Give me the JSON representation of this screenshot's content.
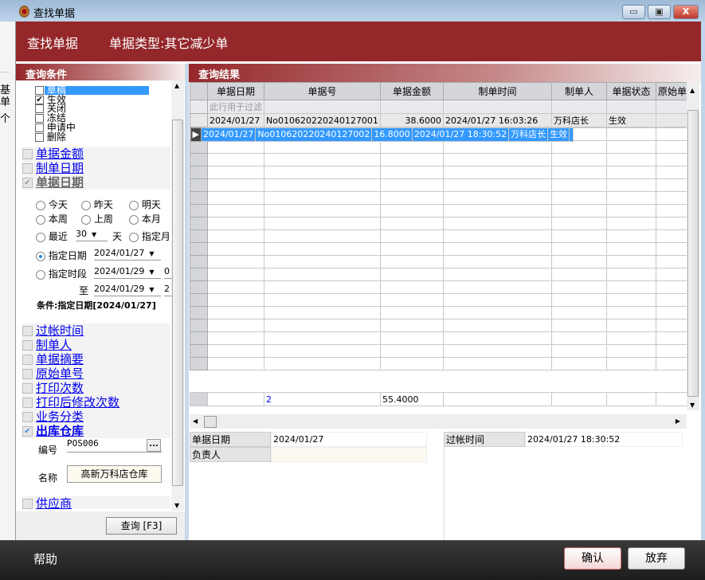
{
  "background_app": {
    "chars": [
      "基",
      "单",
      "个"
    ]
  },
  "window": {
    "title": "查找单据",
    "minimize": "▭",
    "maximize": "▣",
    "close": "X"
  },
  "header": {
    "title": "查找单据",
    "doc_type": "单据类型:其它减少单"
  },
  "left": {
    "section_title": "查询条件",
    "statuses": [
      {
        "label": "草稿",
        "checked": false,
        "highlighted": true
      },
      {
        "label": "生效",
        "checked": true
      },
      {
        "label": "关闭",
        "checked": false
      },
      {
        "label": "冻结",
        "checked": false
      },
      {
        "label": "申请中",
        "checked": false
      },
      {
        "label": "删除",
        "checked": false
      }
    ],
    "filters_top": [
      {
        "label": "单据金额",
        "checked": false
      },
      {
        "label": "制单日期",
        "checked": false
      },
      {
        "label": "单据日期",
        "checked": true
      }
    ],
    "date_options": {
      "today": "今天",
      "yesterday": "昨天",
      "tomorrow": "明天",
      "this_week": "本周",
      "last_week": "上周",
      "this_month": "本月",
      "recent": "最近",
      "recent_days": "30",
      "days_unit": "天",
      "specified_month": "指定月",
      "specified_date": "指定日期",
      "specified_date_value": "2024/01/27",
      "specified_period": "指定时段",
      "period_from": "2024/01/29",
      "period_to_label": "至",
      "period_to": "2024/01/29",
      "period_from_time": "0",
      "period_to_time": "2",
      "selected": "specified_date"
    },
    "condition_text": "条件:指定日期[2024/01/27]",
    "filters_bottom": [
      {
        "label": "过帐时间",
        "checked": false
      },
      {
        "label": "制单人",
        "checked": false
      },
      {
        "label": "单据摘要",
        "checked": false
      },
      {
        "label": "原始单号",
        "checked": false
      },
      {
        "label": "打印次数",
        "checked": false
      },
      {
        "label": "打印后修改次数",
        "checked": false
      },
      {
        "label": "业务分类",
        "checked": false
      },
      {
        "label": "出库仓库",
        "checked": true
      }
    ],
    "warehouse": {
      "code_label": "编号",
      "code": "POS006",
      "browse": "...",
      "name_label": "名称",
      "name": "高新万科店仓库"
    },
    "filters_last": [
      {
        "label": "供应商",
        "checked": false
      }
    ],
    "query_button": "查询 [F3]"
  },
  "results": {
    "section_title": "查询结果",
    "columns": [
      "单据日期",
      "单据号",
      "单据金额",
      "制单时间",
      "制单人",
      "单据状态",
      "原始单"
    ],
    "filter_placeholder": "此行用于过滤",
    "rows": [
      [
        "2024/01/27",
        "No010620220240127001",
        "38.6000",
        "2024/01/27 16:03:26",
        "万科店长",
        "生效",
        ""
      ],
      [
        "2024/01/27",
        "No010620220240127002",
        "16.8000",
        "2024/01/27 18:30:52",
        "万科店长",
        "生效",
        ""
      ]
    ],
    "selected_row": 1,
    "footer": {
      "count": "2",
      "total": "55.4000"
    }
  },
  "details": {
    "doc_date_label": "单据日期",
    "doc_date": "2024/01/27",
    "person_label": "负责人",
    "person": "",
    "post_time_label": "过帐时间",
    "post_time": "2024/01/27 18:30:52"
  },
  "bottom": {
    "help": "帮助",
    "confirm": "确认",
    "cancel": "放弃"
  }
}
